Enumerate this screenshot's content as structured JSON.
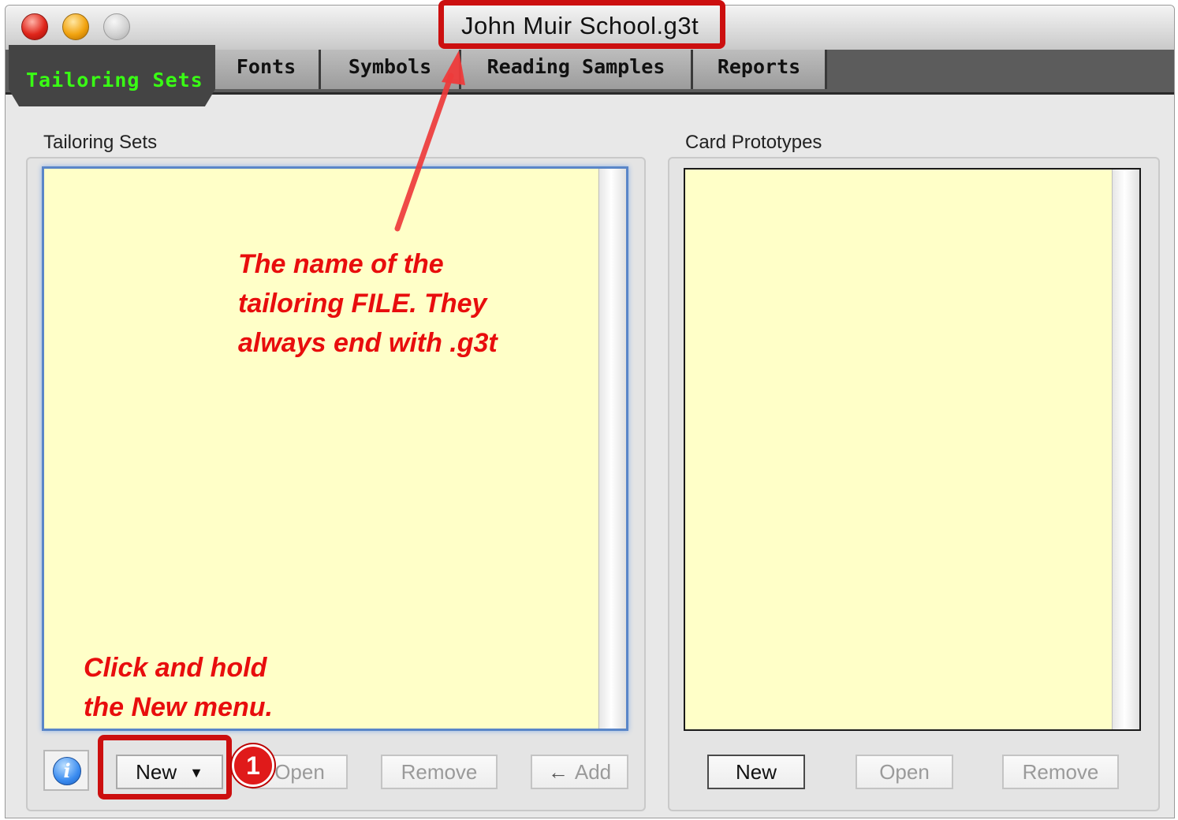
{
  "window": {
    "title": "John Muir School.g3t"
  },
  "tabs": {
    "active": "Tailoring Sets",
    "items": [
      "Fonts",
      "Symbols",
      "Reading Samples",
      "Reports"
    ]
  },
  "left_panel": {
    "label": "Tailoring Sets",
    "buttons": {
      "new": "New",
      "open": "Open",
      "remove": "Remove",
      "add": "Add"
    }
  },
  "right_panel": {
    "label": "Card Prototypes",
    "buttons": {
      "new": "New",
      "open": "Open",
      "remove": "Remove"
    }
  },
  "annotations": {
    "filename_note": [
      "The name of the",
      "tailoring FILE. They",
      "always end with .g3t"
    ],
    "new_menu_note": [
      "Click and hold",
      "the New menu."
    ],
    "step_badge": "1",
    "highlight_color": "#cc0f0f",
    "note_color": "#e80d0d"
  },
  "icons": {
    "info": "info-icon",
    "add_arrow": "arrow-left-icon",
    "dropdown": "triangle-down-icon"
  }
}
